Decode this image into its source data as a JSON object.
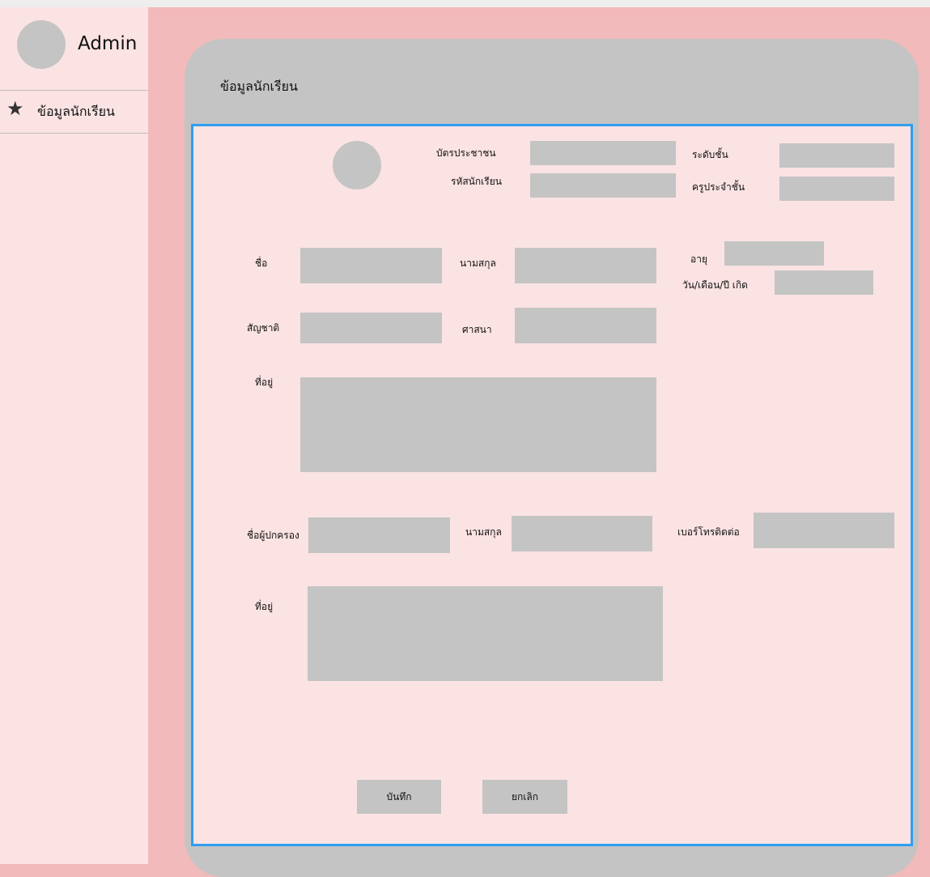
{
  "sidebar": {
    "admin_name": "Admin",
    "items": [
      {
        "label": "ข้อมูลนักเรียน",
        "icon": "star-icon"
      }
    ]
  },
  "card": {
    "title": "ข้อมูลนักเรียน"
  },
  "form": {
    "id_card_label": "บัตรประชาชน",
    "student_id_label": "รหัสนักเรียน",
    "grade_label": "ระดับชั้น",
    "homeroom_teacher_label": "ครูประจำชั้น",
    "first_name_label": "ชื่อ",
    "last_name_label": "นามสกุล",
    "age_label": "อายุ",
    "birth_date_label": "วัน/เดือน/ปี เกิด",
    "nationality_label": "สัญชาติ",
    "religion_label": "ศาสนา",
    "address_label": "ที่อยู่",
    "guardian_name_label": "ชื่อผู้ปกครอง",
    "guardian_last_name_label": "นามสกุล",
    "phone_label": "เบอร์โทรติดต่อ",
    "guardian_address_label": "ที่อยู่",
    "save_label": "บันทึก",
    "cancel_label": "ยกเลิก"
  },
  "colors": {
    "background": "#f2baba",
    "panel": "#fbe3e3",
    "placeholder": "#c4c4c4",
    "accent_border": "#2e9ff0"
  }
}
